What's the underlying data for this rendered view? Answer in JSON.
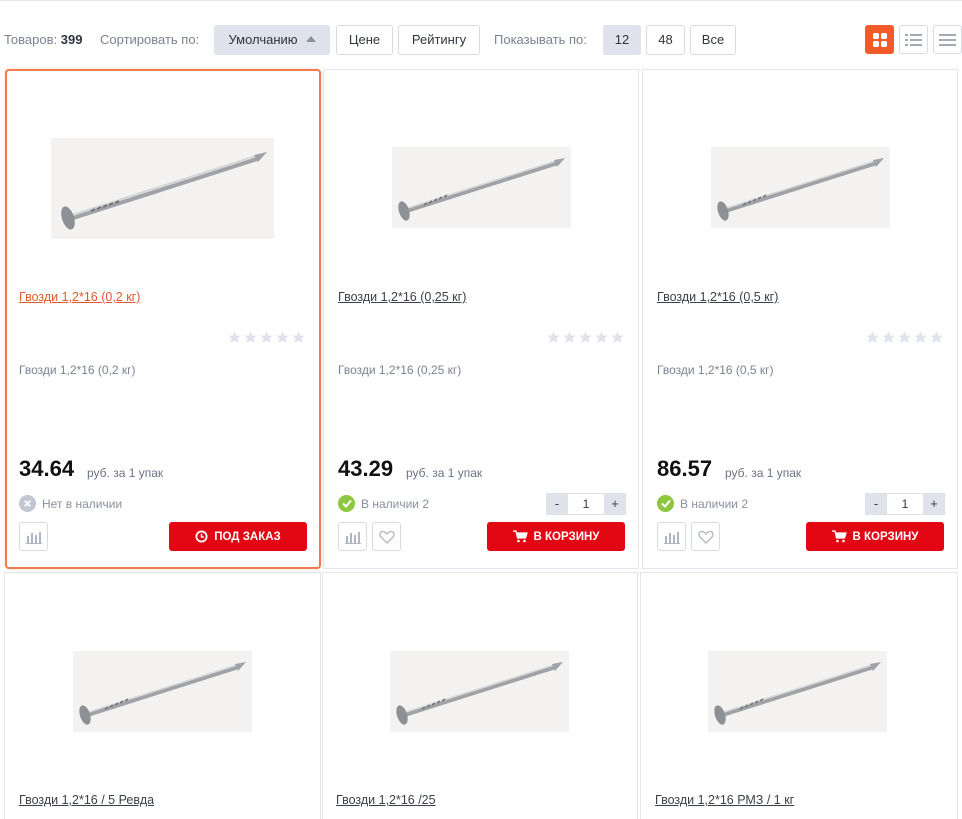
{
  "toolbar": {
    "count_label": "Товаров:",
    "count_value": "399",
    "sort_label": "Сортировать по:",
    "sort_options": [
      "Умолчанию",
      "Цене",
      "Рейтингу"
    ],
    "show_label": "Показывать по:",
    "show_options": [
      "12",
      "48",
      "Все"
    ],
    "view_modes": [
      "grid-view-icon",
      "list-view-icon",
      "table-view-icon"
    ]
  },
  "colors": {
    "accent": "#f15a29",
    "cart_red": "#e30613",
    "in_stock": "#8dc63f",
    "out_of_stock": "#c2c6d0"
  },
  "products": [
    {
      "title": "Гвозди 1,2*16 (0,2 кг)",
      "desc": "Гвозди 1,2*16 (0,2 кг)",
      "price": "34.64",
      "unit": "руб. за 1 упак",
      "stock": "Нет в наличии",
      "in_stock": false,
      "qty": "",
      "button": "ПОД ЗАКАЗ",
      "rating": 0
    },
    {
      "title": "Гвозди 1,2*16 (0,25 кг)",
      "desc": "Гвозди 1,2*16 (0,25 кг)",
      "price": "43.29",
      "unit": "руб. за 1 упак",
      "stock": "В наличии 2",
      "in_stock": true,
      "qty": "1",
      "button": "В КОРЗИНУ",
      "rating": 0
    },
    {
      "title": "Гвозди 1,2*16 (0,5 кг)",
      "desc": "Гвозди 1,2*16 (0,5 кг)",
      "price": "86.57",
      "unit": "руб. за 1 упак",
      "stock": "В наличии 2",
      "in_stock": true,
      "qty": "1",
      "button": "В КОРЗИНУ",
      "rating": 0
    },
    {
      "title": "Гвозди 1,2*16 / 5 Ревда"
    },
    {
      "title": "Гвозди 1,2*16 /25"
    },
    {
      "title": "Гвозди 1,2*16 РМЗ / 1 кг"
    }
  ],
  "stepper": {
    "minus": "-",
    "plus": "+"
  }
}
